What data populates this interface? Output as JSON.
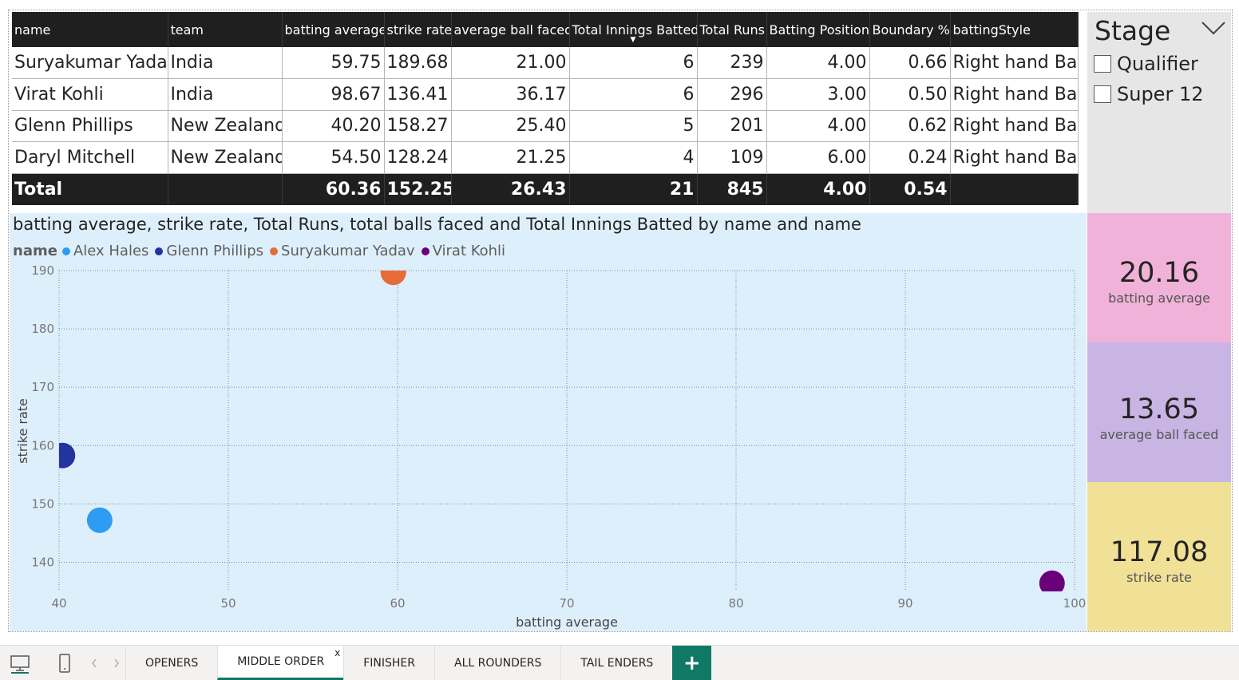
{
  "table": {
    "columns": [
      {
        "label": "name",
        "align": "left"
      },
      {
        "label": "team",
        "align": "left"
      },
      {
        "label": "batting average",
        "align": "right"
      },
      {
        "label": "strike rate",
        "align": "right"
      },
      {
        "label": "average ball faced",
        "align": "right"
      },
      {
        "label": "Total Innings Batted",
        "align": "right",
        "sorted": true
      },
      {
        "label": "Total Runs",
        "align": "right"
      },
      {
        "label": "Batting Position",
        "align": "right"
      },
      {
        "label": "Boundary %",
        "align": "right"
      },
      {
        "label": "battingStyle",
        "align": "left"
      }
    ],
    "rows": [
      [
        "Suryakumar Yadav",
        "India",
        "59.75",
        "189.68",
        "21.00",
        "6",
        "239",
        "4.00",
        "0.66",
        "Right hand Bat"
      ],
      [
        "Virat Kohli",
        "India",
        "98.67",
        "136.41",
        "36.17",
        "6",
        "296",
        "3.00",
        "0.50",
        "Right hand Bat"
      ],
      [
        "Glenn Phillips",
        "New Zealand",
        "40.20",
        "158.27",
        "25.40",
        "5",
        "201",
        "4.00",
        "0.62",
        "Right hand Bat"
      ],
      [
        "Daryl Mitchell",
        "New Zealand",
        "54.50",
        "128.24",
        "21.25",
        "4",
        "109",
        "6.00",
        "0.24",
        "Right hand Bat"
      ]
    ],
    "total": [
      "Total",
      "",
      "60.36",
      "152.25",
      "26.43",
      "21",
      "845",
      "4.00",
      "0.54",
      ""
    ]
  },
  "slicer": {
    "title": "Stage",
    "options": [
      "Qualifier",
      "Super 12"
    ]
  },
  "chart_data": {
    "type": "scatter",
    "title": "batting average, strike rate, Total Runs, total balls faced and Total Innings Batted by name and name",
    "legend_title": "name",
    "xlabel": "batting average",
    "ylabel": "strike rate",
    "xlim": [
      40,
      100
    ],
    "ylim": [
      135,
      190
    ],
    "xticks": [
      40,
      50,
      60,
      70,
      80,
      90,
      100
    ],
    "yticks": [
      140,
      150,
      160,
      170,
      180,
      190
    ],
    "grid": true,
    "legend_position": "top-left",
    "series": [
      {
        "name": "Alex Hales",
        "color": "#2e9cf2",
        "points": [
          {
            "x": 42.4,
            "y": 147.2
          }
        ]
      },
      {
        "name": "Glenn Phillips",
        "color": "#24349e",
        "points": [
          {
            "x": 40.2,
            "y": 158.3
          }
        ]
      },
      {
        "name": "Suryakumar Yadav",
        "color": "#e66c37",
        "points": [
          {
            "x": 59.75,
            "y": 189.7
          }
        ]
      },
      {
        "name": "Virat Kohli",
        "color": "#6b007b",
        "points": [
          {
            "x": 98.67,
            "y": 136.4
          }
        ]
      }
    ]
  },
  "cards": [
    {
      "value": "20.16",
      "label": "batting average"
    },
    {
      "value": "13.65",
      "label": "average ball faced"
    },
    {
      "value": "117.08",
      "label": "strike rate"
    }
  ],
  "pages": {
    "tabs": [
      "OPENERS",
      "MIDDLE ORDER",
      "FINISHER",
      "ALL ROUNDERS",
      "TAIL ENDERS"
    ],
    "active_tab": "MIDDLE ORDER",
    "close_glyph": "x",
    "add_glyph": "+"
  },
  "toolbar_icons": [
    "desktop-icon",
    "mobile-icon",
    "prev-page-icon",
    "next-page-icon"
  ]
}
